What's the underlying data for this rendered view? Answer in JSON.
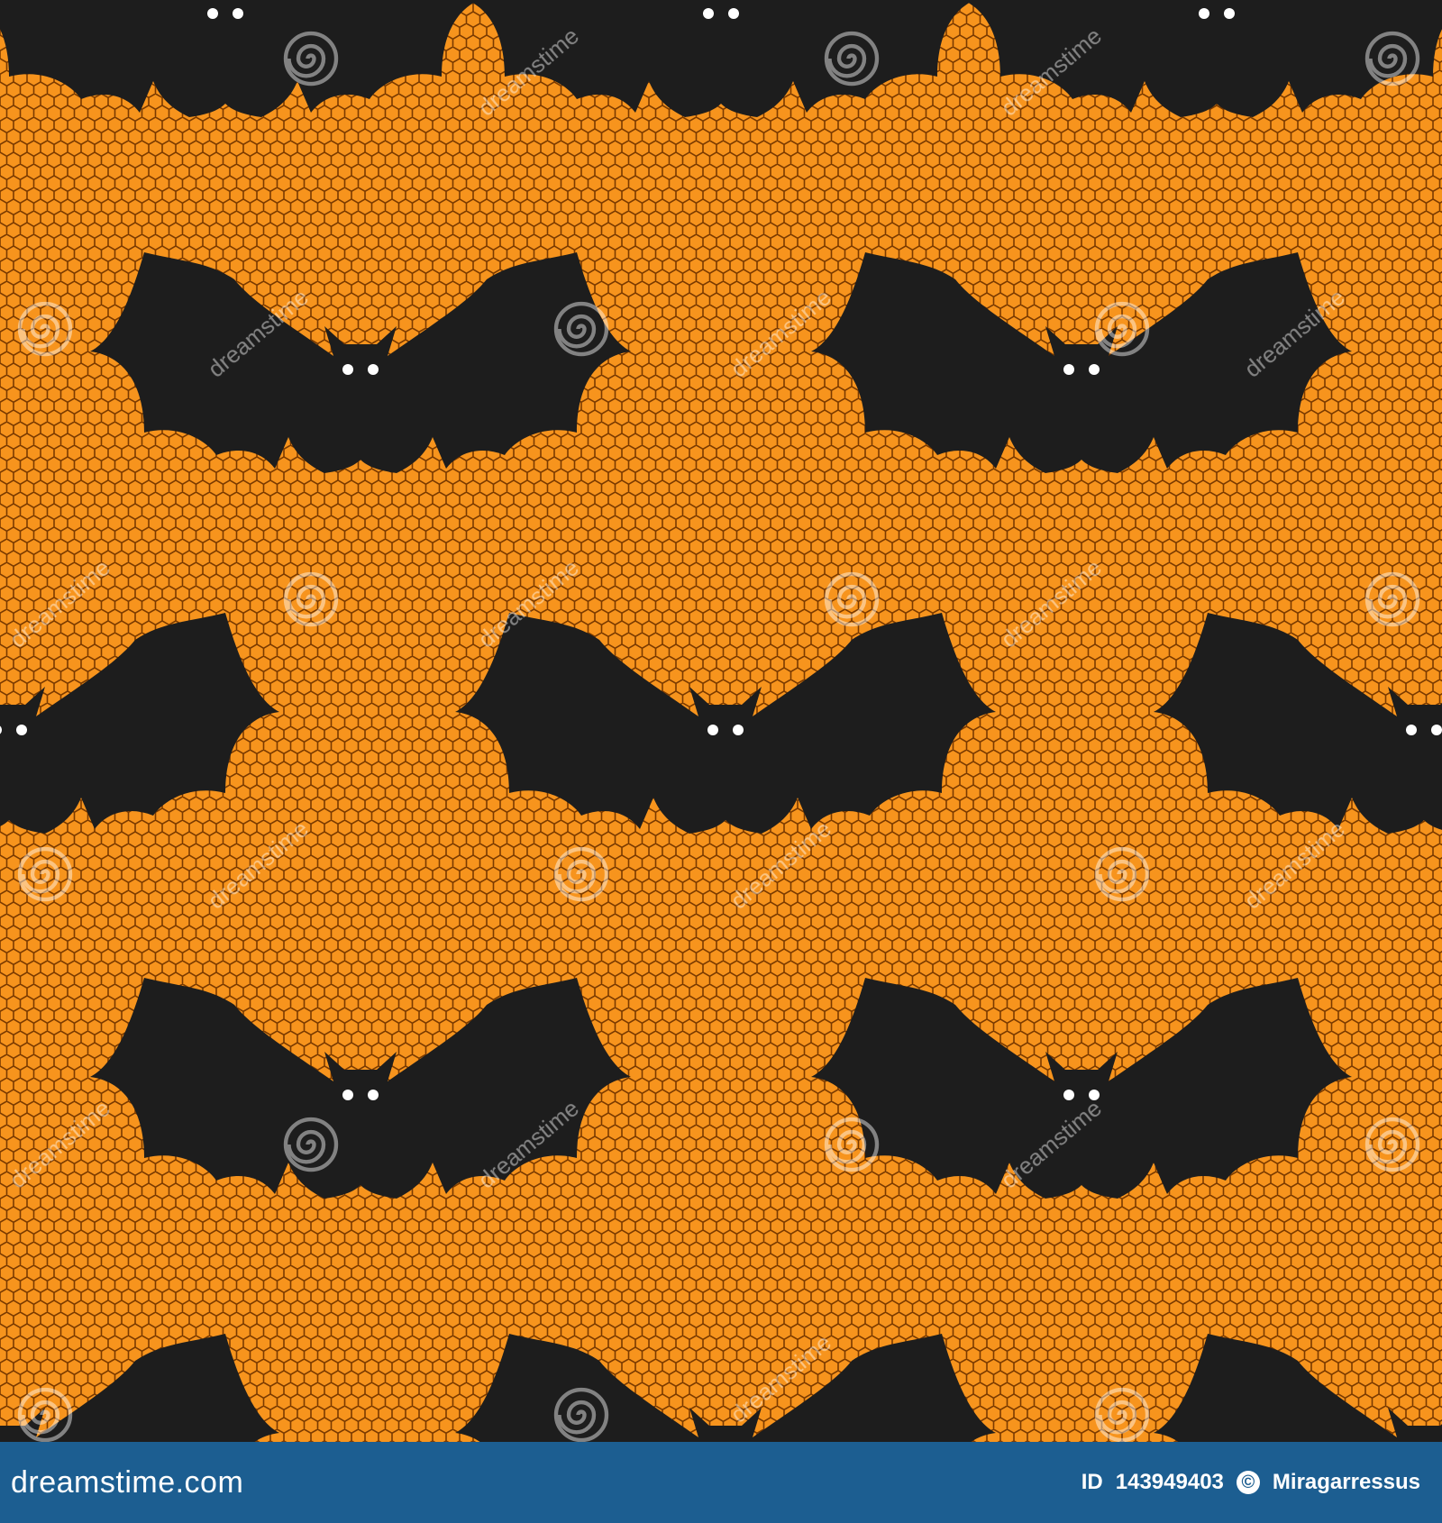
{
  "artwork": {
    "subject": "bat-pattern",
    "colors": {
      "background": "#f7941d",
      "mesh_line": "#7a3a00",
      "bat": "#1d1d1d",
      "eyes": "#ffffff",
      "watermark": "#ffffff"
    }
  },
  "watermark": {
    "text": "dreamstime",
    "icon": "dreamstime-spiral-icon"
  },
  "footer": {
    "brand": "dreamstime.com",
    "id_label": "ID",
    "id_value": "143949403",
    "copyright_icon": "copyright-icon",
    "author": "Miragarressus",
    "background": "#1c5e91"
  }
}
